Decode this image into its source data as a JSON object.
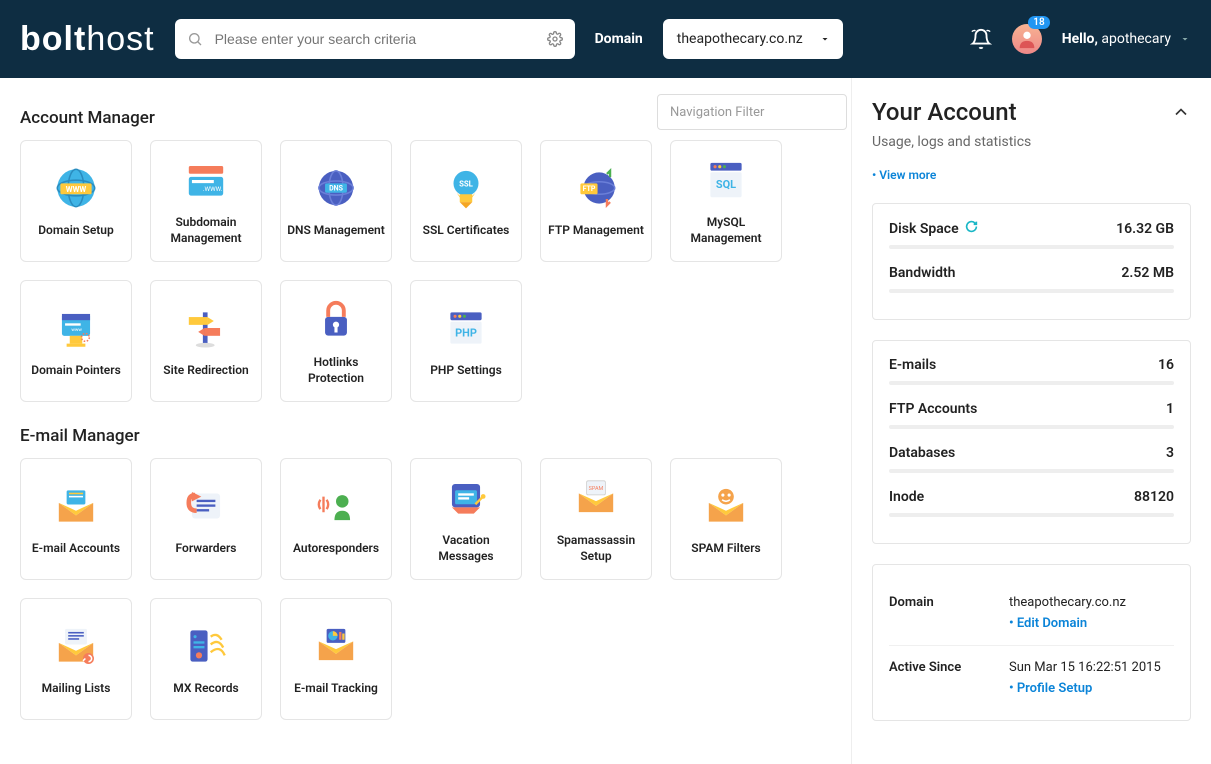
{
  "header": {
    "logo_a": "bolt",
    "logo_b": "host",
    "search_placeholder": "Please enter your search criteria",
    "domain_label": "Domain",
    "domain_value": "theapothecary.co.nz",
    "badge": "18",
    "hello_prefix": "Hello,",
    "hello_user": "apothecary"
  },
  "nav_filter_placeholder": "Navigation Filter",
  "sections": {
    "account_manager": {
      "title": "Account Manager",
      "cards": [
        {
          "label": "Domain Setup",
          "icon": "www"
        },
        {
          "label": "Subdomain Management",
          "icon": "subdomain"
        },
        {
          "label": "DNS Management",
          "icon": "dns"
        },
        {
          "label": "SSL Certificates",
          "icon": "ssl"
        },
        {
          "label": "FTP Management",
          "icon": "ftp"
        },
        {
          "label": "MySQL Management",
          "icon": "sql"
        },
        {
          "label": "Domain Pointers",
          "icon": "pointers"
        },
        {
          "label": "Site Redirection",
          "icon": "redirect"
        },
        {
          "label": "Hotlinks Protection",
          "icon": "lock"
        },
        {
          "label": "PHP Settings",
          "icon": "php"
        }
      ]
    },
    "email_manager": {
      "title": "E-mail Manager",
      "cards": [
        {
          "label": "E-mail Accounts",
          "icon": "email"
        },
        {
          "label": "Forwarders",
          "icon": "forward"
        },
        {
          "label": "Autoresponders",
          "icon": "auto"
        },
        {
          "label": "Vacation Messages",
          "icon": "vacation"
        },
        {
          "label": "Spamassassin Setup",
          "icon": "spamassassin"
        },
        {
          "label": "SPAM Filters",
          "icon": "spam"
        },
        {
          "label": "Mailing Lists",
          "icon": "mailing"
        },
        {
          "label": "MX Records",
          "icon": "mx"
        },
        {
          "label": "E-mail Tracking",
          "icon": "tracking"
        }
      ]
    }
  },
  "sidebar": {
    "title": "Your Account",
    "subtitle": "Usage, logs and statistics",
    "view_more": "• View more",
    "usage": [
      {
        "label": "Disk Space",
        "value": "16.32 GB",
        "refresh": true
      },
      {
        "label": "Bandwidth",
        "value": "2.52 MB"
      }
    ],
    "counts": [
      {
        "label": "E-mails",
        "value": "16"
      },
      {
        "label": "FTP Accounts",
        "value": "1"
      },
      {
        "label": "Databases",
        "value": "3"
      },
      {
        "label": "Inode",
        "value": "88120"
      }
    ],
    "info": {
      "domain_label": "Domain",
      "domain_value": "theapothecary.co.nz",
      "edit_domain": "• Edit Domain",
      "active_label": "Active Since",
      "active_value": "Sun Mar 15 16:22:51 2015",
      "profile_setup": "• Profile Setup"
    }
  }
}
